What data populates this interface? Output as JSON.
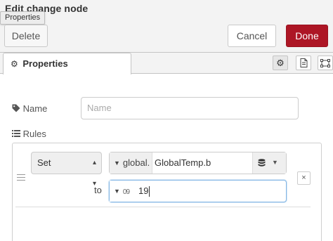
{
  "tray": {
    "title": "Edit change node",
    "tooltip": "Properties",
    "delete_label": "Delete",
    "cancel_label": "Cancel",
    "done_label": "Done"
  },
  "tabs": {
    "properties_label": "Properties"
  },
  "form": {
    "name_label": "Name",
    "name_placeholder": "Name",
    "rules_label": "Rules"
  },
  "rule": {
    "action": "Set",
    "target_type": "global.",
    "target_value": "GlobalTemp.b",
    "to_label": "to",
    "value_type_icon": "09",
    "value": "19",
    "remove_label": "×"
  },
  "icons": {
    "tab_gear": "gear-icon",
    "tab_description": "document-icon",
    "tab_appearance": "frame-icon",
    "name_tag": "tag-icon",
    "rules_list": "list-icon",
    "env_context": "database-icon"
  },
  "colors": {
    "done_button": "#ad1625",
    "focus_border": "#85b7e5"
  }
}
